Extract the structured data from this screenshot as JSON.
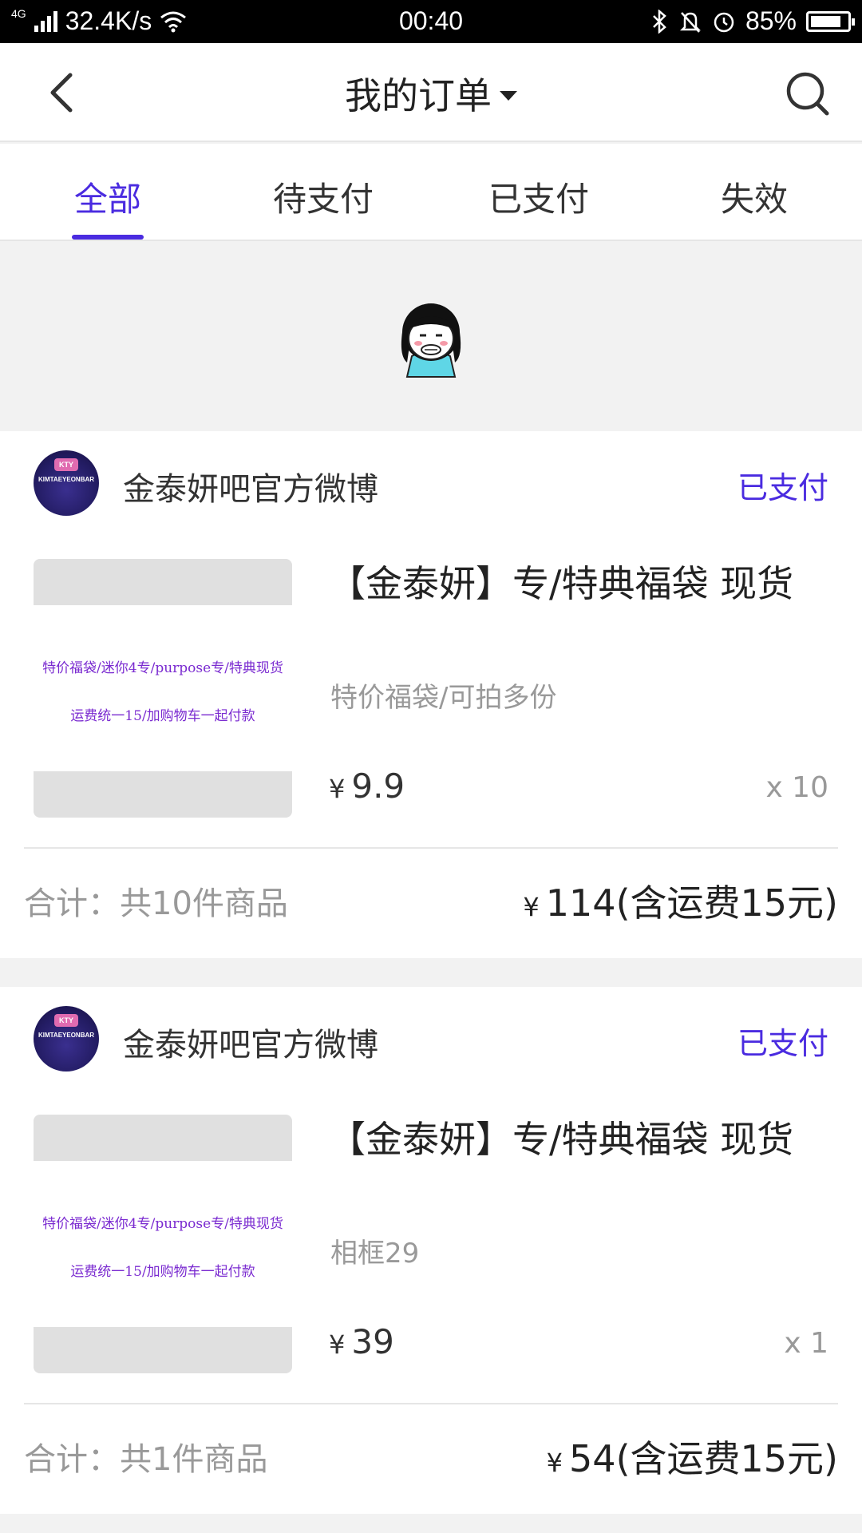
{
  "status_bar": {
    "network_type": "4G",
    "speed": "32.4K/s",
    "time": "00:40",
    "battery": "85%",
    "battery_level": 0.85
  },
  "header": {
    "title": "我的订单"
  },
  "tabs": [
    {
      "label": "全部",
      "active": true
    },
    {
      "label": "待支付",
      "active": false
    },
    {
      "label": "已支付",
      "active": false
    },
    {
      "label": "失效",
      "active": false
    }
  ],
  "orders": [
    {
      "shop": {
        "name": "金泰妍吧官方微博",
        "logo_text": "KTY",
        "logo_brand": "KIMTAEYEONBAR"
      },
      "status": "已支付",
      "product": {
        "title": "【金泰妍】专/特典福袋 现货",
        "spec": "特价福袋/可拍多份",
        "image_line1": "特价福袋/迷你4专/purpose专/特典现货",
        "image_line2": "运费统一15/加购物车一起付款",
        "currency": "¥",
        "price": "9.9",
        "quantity": "x 10"
      },
      "total_label": "合计：共10件商品",
      "total_currency": "¥",
      "total_amount": "114(含运费15元)"
    },
    {
      "shop": {
        "name": "金泰妍吧官方微博",
        "logo_text": "KTY",
        "logo_brand": "KIMTAEYEONBAR"
      },
      "status": "已支付",
      "product": {
        "title": "【金泰妍】专/特典福袋 现货",
        "spec": "相框29",
        "image_line1": "特价福袋/迷你4专/purpose专/特典现货",
        "image_line2": "运费统一15/加购物车一起付款",
        "currency": "¥",
        "price": "39",
        "quantity": "x 1"
      },
      "total_label": "合计：共1件商品",
      "total_currency": "¥",
      "total_amount": "54(含运费15元)"
    }
  ],
  "colors": {
    "accent": "#4a2be0",
    "background": "#f2f2f2"
  }
}
